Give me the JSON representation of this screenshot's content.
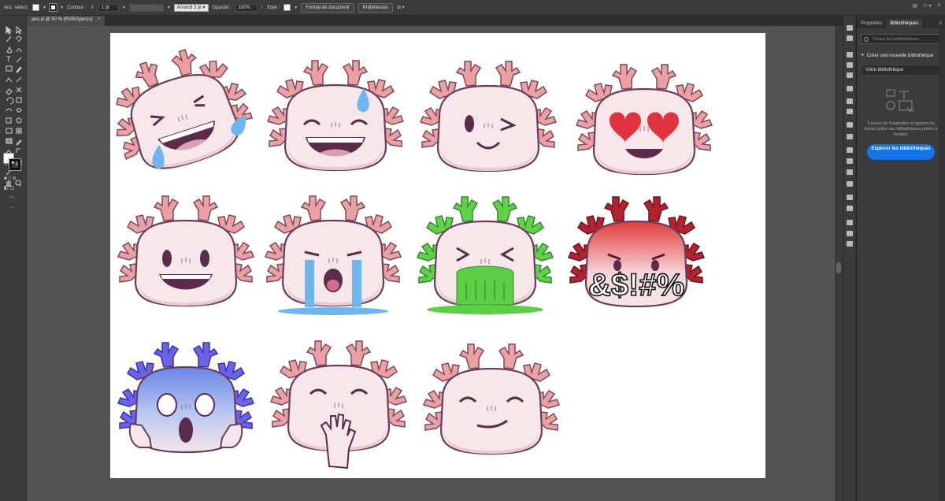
{
  "control_bar": {
    "selection_label": "Auc. sélect.",
    "stroke_label": "Contour :",
    "stroke_value": "1 pt",
    "brush_label": "Arrondi 3 pt",
    "opacity_label": "Opacité :",
    "opacity_value": "100%",
    "style_label": "Style :",
    "doc_format_button": "Format de document",
    "preferences_button": "Préférences"
  },
  "document_tab": {
    "title": "axo.ai @ 50 % (RVB/Aperçu)",
    "close": "×"
  },
  "panel": {
    "tabs": [
      "Propriétés",
      "Bibliothèques"
    ],
    "active_tab": "Bibliothèques",
    "menu_icon": "≡",
    "search_placeholder": "Toutes les bibliothèques",
    "create_label": "Créer une nouvelle bibliothèque",
    "your_library": "Votre bibliothèque",
    "description": "Trouvez de l'inspiration et gagnez du temps grâce aux bibliothèques prêtes à l'emploi.",
    "cta_label": "Explorer les bibliothèques"
  },
  "artwork": {
    "rage_symbols": "&$!#%"
  },
  "colors": {
    "ui_bg": "#323232",
    "panel_bg": "#3b3b3b",
    "canvas_bg": "#535353",
    "accent": "#1473e6",
    "axolotl_body": "#f7e6ea",
    "axolotl_gill": "#eba0a4",
    "outline": "#6b3d5a"
  },
  "icons": [
    "selection-tool-icon",
    "direct-selection-tool-icon",
    "pen-tool-icon",
    "type-tool-icon",
    "rectangle-tool-icon",
    "brush-tool-icon",
    "eraser-tool-icon",
    "rotate-tool-icon",
    "scale-tool-icon",
    "eyedropper-tool-icon",
    "hand-tool-icon",
    "zoom-tool-icon",
    "fill-swatch-icon",
    "stroke-swatch-icon",
    "more-tools-icon"
  ]
}
